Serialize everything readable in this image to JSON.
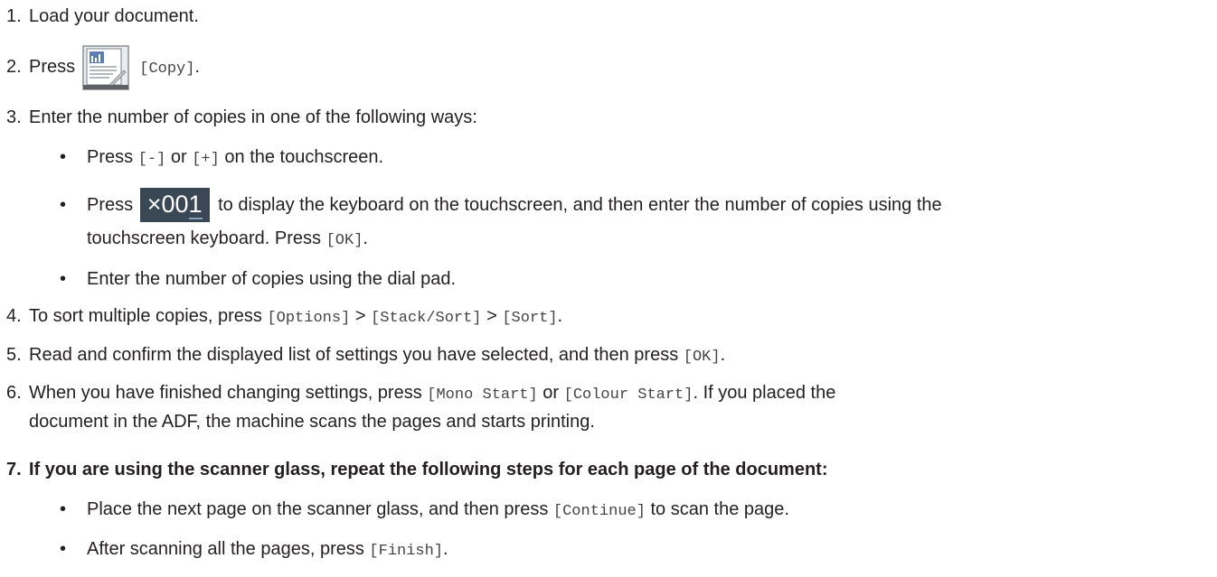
{
  "steps": [
    {
      "num": "1.",
      "text": "Load your document."
    },
    {
      "num": "2.",
      "pre": "Press",
      "mono": "[Copy]",
      "post": "."
    },
    {
      "num": "3.",
      "text": "Enter the number of copies in one of the following ways:",
      "bullets": [
        {
          "pre": "Press",
          "mono1": "[-]",
          "mid": "or",
          "mono2": "[+]",
          "post": "on the touchscreen."
        },
        {
          "pre": "Press",
          "btn_prefix": "×00",
          "btn_digit": "1",
          "text": "to display the keyboard on the touchscreen, and then enter the number of copies using the",
          "cont": "touchscreen keyboard. Press",
          "mono": "[OK]",
          "post": "."
        },
        {
          "text": "Enter the number of copies using the dial pad."
        }
      ]
    },
    {
      "num": "4.",
      "pre": "To sort multiple copies, press",
      "mono1": "[Options]",
      "sep1": ">",
      "mono2": "[Stack/Sort]",
      "sep2": ">",
      "mono3": "[Sort]",
      "post": "."
    },
    {
      "num": "5.",
      "pre": "Read and confirm the displayed list of settings you have selected, and then press",
      "mono": "[OK]",
      "post": "."
    },
    {
      "num": "6.",
      "pre": "When you have finished changing settings, press",
      "mono1": "[Mono Start]",
      "mid": "or",
      "mono2": "[Colour Start]",
      "post": ". If you placed the",
      "cont": "document in the ADF, the machine scans the pages and starts printing."
    },
    {
      "num": "7.",
      "text": "If you are using the scanner glass, repeat the following steps for each page of the document:",
      "bullets": [
        {
          "pre": "Place the next page on the scanner glass, and then press",
          "mono": "[Continue]",
          "post": "to scan the page."
        },
        {
          "pre": "After scanning all the pages, press",
          "mono": "[Finish]",
          "post": "."
        }
      ]
    }
  ],
  "bullet_char": "•",
  "icons": {
    "copy": "copy-document-icon"
  }
}
